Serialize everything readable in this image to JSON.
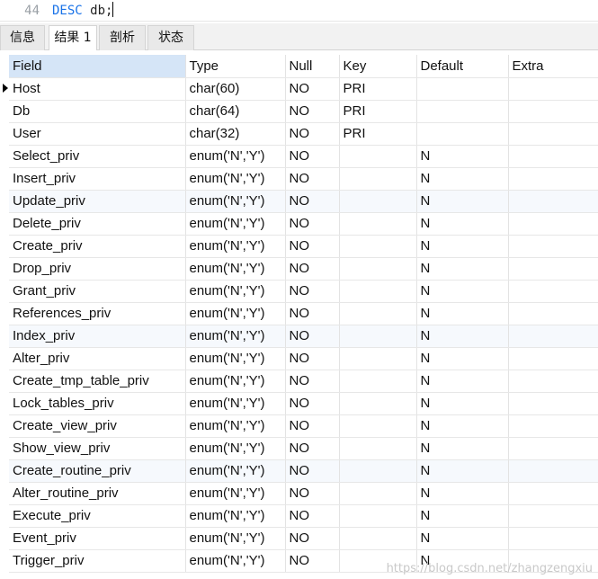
{
  "editor": {
    "line_number": "44",
    "keyword": "DESC",
    "rest": " db;"
  },
  "tabs": [
    {
      "label": "信息"
    },
    {
      "label": "结果 1"
    },
    {
      "label": "剖析"
    },
    {
      "label": "状态"
    }
  ],
  "columns": [
    "Field",
    "Type",
    "Null",
    "Key",
    "Default",
    "Extra"
  ],
  "rows": [
    [
      "Host",
      "char(60)",
      "NO",
      "PRI",
      "",
      ""
    ],
    [
      "Db",
      "char(64)",
      "NO",
      "PRI",
      "",
      ""
    ],
    [
      "User",
      "char(32)",
      "NO",
      "PRI",
      "",
      ""
    ],
    [
      "Select_priv",
      "enum('N','Y')",
      "NO",
      "",
      "N",
      ""
    ],
    [
      "Insert_priv",
      "enum('N','Y')",
      "NO",
      "",
      "N",
      ""
    ],
    [
      "Update_priv",
      "enum('N','Y')",
      "NO",
      "",
      "N",
      ""
    ],
    [
      "Delete_priv",
      "enum('N','Y')",
      "NO",
      "",
      "N",
      ""
    ],
    [
      "Create_priv",
      "enum('N','Y')",
      "NO",
      "",
      "N",
      ""
    ],
    [
      "Drop_priv",
      "enum('N','Y')",
      "NO",
      "",
      "N",
      ""
    ],
    [
      "Grant_priv",
      "enum('N','Y')",
      "NO",
      "",
      "N",
      ""
    ],
    [
      "References_priv",
      "enum('N','Y')",
      "NO",
      "",
      "N",
      ""
    ],
    [
      "Index_priv",
      "enum('N','Y')",
      "NO",
      "",
      "N",
      ""
    ],
    [
      "Alter_priv",
      "enum('N','Y')",
      "NO",
      "",
      "N",
      ""
    ],
    [
      "Create_tmp_table_priv",
      "enum('N','Y')",
      "NO",
      "",
      "N",
      ""
    ],
    [
      "Lock_tables_priv",
      "enum('N','Y')",
      "NO",
      "",
      "N",
      ""
    ],
    [
      "Create_view_priv",
      "enum('N','Y')",
      "NO",
      "",
      "N",
      ""
    ],
    [
      "Show_view_priv",
      "enum('N','Y')",
      "NO",
      "",
      "N",
      ""
    ],
    [
      "Create_routine_priv",
      "enum('N','Y')",
      "NO",
      "",
      "N",
      ""
    ],
    [
      "Alter_routine_priv",
      "enum('N','Y')",
      "NO",
      "",
      "N",
      ""
    ],
    [
      "Execute_priv",
      "enum('N','Y')",
      "NO",
      "",
      "N",
      ""
    ],
    [
      "Event_priv",
      "enum('N','Y')",
      "NO",
      "",
      "N",
      ""
    ],
    [
      "Trigger_priv",
      "enum('N','Y')",
      "NO",
      "",
      "N",
      ""
    ]
  ],
  "watermark": "https://blog.csdn.net/zhangzengxiu"
}
